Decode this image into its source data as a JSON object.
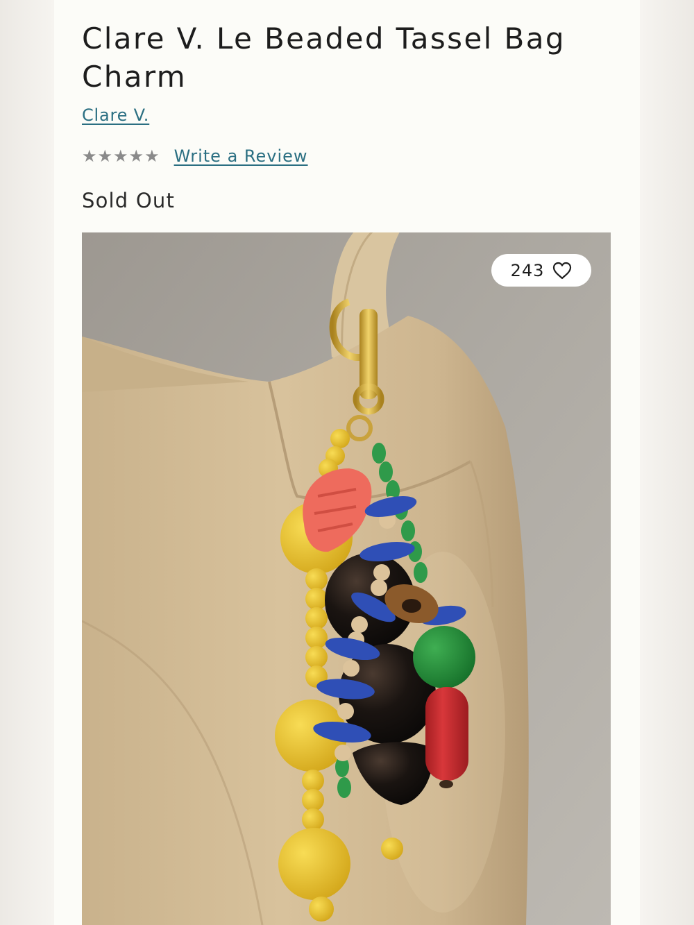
{
  "product": {
    "title": "Clare V. Le Beaded Tassel Bag Charm",
    "brand": "Clare V.",
    "rating": {
      "stars": [
        "★",
        "★",
        "★",
        "★",
        "★"
      ],
      "filled": 0,
      "color": "#8a8a8a"
    },
    "review_link": "Write a Review",
    "stock_status": "Sold Out"
  },
  "image": {
    "like_count": "243",
    "like_icon": "heart-icon"
  },
  "colors": {
    "link": "#2b6f82",
    "text": "#1d1d1d",
    "panel": "#fcfcf8"
  }
}
